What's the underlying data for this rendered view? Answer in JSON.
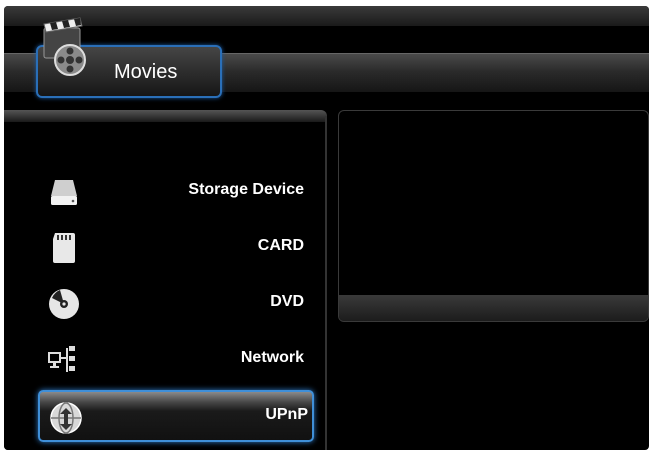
{
  "header": {
    "title": "Movies",
    "icon": "clapperboard-film-reel-icon"
  },
  "menu": {
    "items": [
      {
        "label": "Storage Device",
        "icon": "storage-device-icon"
      },
      {
        "label": "CARD",
        "icon": "sd-card-icon"
      },
      {
        "label": "DVD",
        "icon": "dvd-disc-icon"
      },
      {
        "label": "Network",
        "icon": "network-icon"
      },
      {
        "label": "UPnP",
        "icon": "upnp-globe-icon",
        "selected": true
      }
    ]
  },
  "colors": {
    "accent": "#3f8fd8",
    "background": "#000000",
    "text": "#ffffff"
  }
}
